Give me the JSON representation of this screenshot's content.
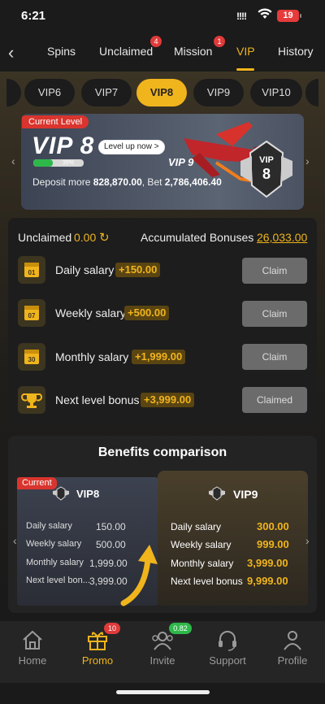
{
  "status": {
    "time": "6:21",
    "signal": "!!!!",
    "battery": "19"
  },
  "nav": {
    "tabs": [
      {
        "label": "Spins"
      },
      {
        "label": "Unclaimed",
        "badge": "4"
      },
      {
        "label": "Mission",
        "badge": "1"
      },
      {
        "label": "VIP"
      },
      {
        "label": "History"
      }
    ],
    "active": "VIP"
  },
  "vip_tabs": [
    "VIP6",
    "VIP7",
    "VIP8",
    "VIP9",
    "VIP10"
  ],
  "active_vip": "VIP8",
  "banner": {
    "current_level_tag": "Current Level",
    "level": "VIP 8",
    "level_up": "Level up now >",
    "progress_pct": "39%",
    "progress_value": 0.39,
    "next_level": "VIP 9",
    "emblem_top": "VIP",
    "emblem_num": "8",
    "deposit_text": "Deposit more ",
    "deposit_amount": "828,870.00",
    "bet_text": ", Bet ",
    "bet_amount": "2,786,406.40"
  },
  "salary": {
    "unclaimed_label": "Unclaimed",
    "unclaimed_value": "0.00",
    "accum_label": "Accumulated Bonuses",
    "accum_value": "26,033.00",
    "rows": [
      {
        "label": "Daily salary",
        "amount": "+150.00",
        "button": "Claim",
        "icon_text": "01"
      },
      {
        "label": "Weekly salary",
        "amount": "+500.00",
        "button": "Claim",
        "icon_text": "07"
      },
      {
        "label": "Monthly salary",
        "amount": "+1,999.00",
        "button": "Claim",
        "icon_text": "30"
      },
      {
        "label": "Next level bonus",
        "amount": "+3,999.00",
        "button": "Claimed",
        "icon_text": ""
      }
    ]
  },
  "benefits": {
    "title": "Benefits comparison",
    "current_tag": "Current",
    "left": {
      "name": "VIP8",
      "rows": [
        {
          "label": "Daily salary",
          "value": "150.00"
        },
        {
          "label": "Weekly salary",
          "value": "500.00"
        },
        {
          "label": "Monthly salary",
          "value": "1,999.00"
        },
        {
          "label": "Next level bon...",
          "value": "3,999.00"
        }
      ]
    },
    "right": {
      "name": "VIP9",
      "rows": [
        {
          "label": "Daily salary",
          "value": "300.00"
        },
        {
          "label": "Weekly salary",
          "value": "999.00"
        },
        {
          "label": "Monthly salary",
          "value": "3,999.00"
        },
        {
          "label": "Next level bonus",
          "value": "9,999.00"
        }
      ]
    }
  },
  "bottom_nav": [
    {
      "label": "Home",
      "icon": "home-icon"
    },
    {
      "label": "Promo",
      "icon": "gift-icon",
      "badge": "10"
    },
    {
      "label": "Invite",
      "icon": "invite-icon",
      "badge": "0.82"
    },
    {
      "label": "Support",
      "icon": "headset-icon"
    },
    {
      "label": "Profile",
      "icon": "profile-icon"
    }
  ],
  "colors": {
    "accent": "#f0b41c",
    "badge": "#e03a3a",
    "progress": "#2fb84a",
    "current_tag": "#d9352e"
  }
}
